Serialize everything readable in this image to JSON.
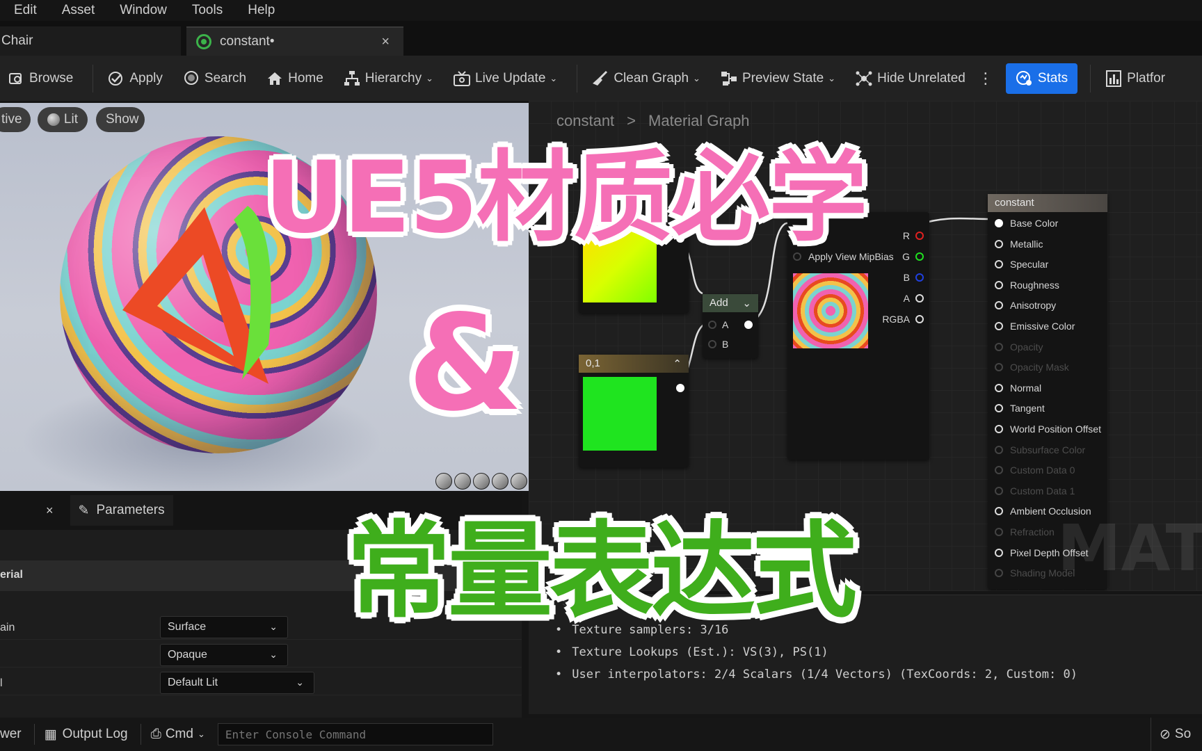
{
  "menu": [
    "Edit",
    "Asset",
    "Window",
    "Tools",
    "Help"
  ],
  "tabs": {
    "inactive": "Chair",
    "active": "constant•",
    "close": "×"
  },
  "toolbar": {
    "browse": "Browse",
    "apply": "Apply",
    "search": "Search",
    "home": "Home",
    "hierarchy": "Hierarchy",
    "live_update": "Live Update",
    "clean_graph": "Clean Graph",
    "preview_state": "Preview State",
    "hide_unrelated": "Hide Unrelated",
    "stats": "Stats",
    "platform": "Platfor",
    "stats_color": "#1a6fe8"
  },
  "viewport": {
    "perspective": "tive",
    "lit": "Lit",
    "show": "Show"
  },
  "graph": {
    "breadcrumb": [
      "constant",
      ">",
      "Material Graph"
    ],
    "nodes": {
      "constant3": {
        "output_color": "#d8ff00"
      },
      "add": {
        "title": "Add",
        "pin_a": "A",
        "pin_b": "B"
      },
      "constant_01": {
        "title": "0,1",
        "preview_color": "#1fe41f"
      },
      "texture": {
        "pins_in": [
          "Tex",
          "Apply View MipBias"
        ],
        "pins_out": [
          "R",
          "G",
          "B",
          "A",
          "RGBA"
        ]
      },
      "result": {
        "title": "constant",
        "pins": [
          {
            "label": "Base Color",
            "active": true
          },
          {
            "label": "Metallic",
            "active": true
          },
          {
            "label": "Specular",
            "active": true
          },
          {
            "label": "Roughness",
            "active": true
          },
          {
            "label": "Anisotropy",
            "active": true
          },
          {
            "label": "Emissive Color",
            "active": true
          },
          {
            "label": "Opacity",
            "active": false
          },
          {
            "label": "Opacity Mask",
            "active": false
          },
          {
            "label": "Normal",
            "active": true
          },
          {
            "label": "Tangent",
            "active": true
          },
          {
            "label": "World Position Offset",
            "active": true
          },
          {
            "label": "Subsurface Color",
            "active": false
          },
          {
            "label": "Custom Data 0",
            "active": false
          },
          {
            "label": "Custom Data 1",
            "active": false
          },
          {
            "label": "Ambient Occlusion",
            "active": true
          },
          {
            "label": "Refraction",
            "active": false
          },
          {
            "label": "Pixel Depth Offset",
            "active": true
          },
          {
            "label": "Shading Model",
            "active": false
          }
        ]
      }
    },
    "watermark": "MATERI"
  },
  "stats_panel": {
    "title": "Stats",
    "lines": [
      "Texture samplers: 3/16",
      "Texture Lookups (Est.): VS(3), PS(1)",
      "User interpolators: 2/4 Scalars (1/4 Vectors) (TexCoords: 2, Custom: 0)"
    ]
  },
  "left_panel": {
    "close": "×",
    "parameters_tab": "Parameters",
    "section": "erial",
    "properties": [
      {
        "label": "ain",
        "value": "Surface"
      },
      {
        "label": "",
        "value": "Opaque"
      },
      {
        "label": "l",
        "value": "Default Lit"
      }
    ]
  },
  "bottom_bar": {
    "browser": "wer",
    "output_log": "Output Log",
    "cmd": "Cmd",
    "console_placeholder": "Enter Console Command",
    "source_control": "So"
  },
  "overlay": {
    "title": "UE5材质必学",
    "amp": "&",
    "subtitle": "常量表达式",
    "title_color": "#f56fb6",
    "subtitle_color": "#3fae1c"
  }
}
